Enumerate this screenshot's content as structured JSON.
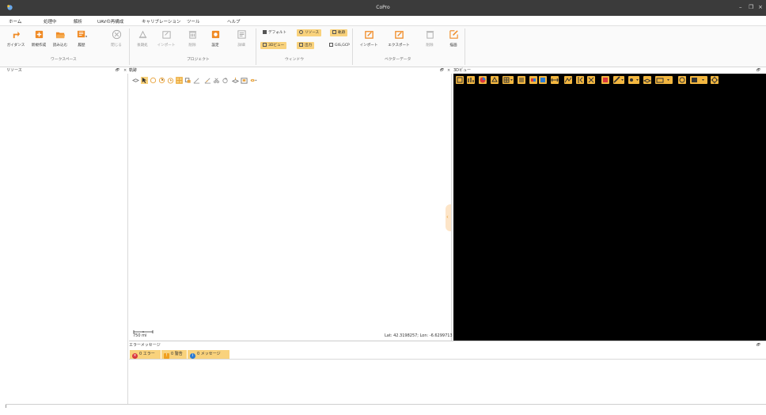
{
  "app": {
    "title": "CoPro"
  },
  "window_controls": {
    "minimize": "–",
    "restore": "❐",
    "close": "×"
  },
  "menu": {
    "tabs": [
      {
        "label": "ホーム",
        "active": true
      },
      {
        "label": "処理中"
      },
      {
        "label": "解析"
      },
      {
        "label": "UAVの再構成"
      },
      {
        "label": "キャリブレーション"
      },
      {
        "label": "ツール"
      },
      {
        "label": "ヘルプ"
      }
    ]
  },
  "ribbon": {
    "workspace": {
      "group_label": "ワークスペース",
      "buttons": [
        {
          "label": "ガイダンス",
          "icon": "guidance-icon"
        },
        {
          "label": "新規作成",
          "icon": "new-project-icon"
        },
        {
          "label": "読み込む",
          "icon": "open-folder-icon"
        },
        {
          "label": "履歴",
          "icon": "history-icon"
        },
        {
          "label": "閉じる",
          "icon": "close-circle-icon"
        }
      ]
    },
    "project": {
      "group_label": "プロジェクト",
      "buttons": [
        {
          "label": "後期処",
          "icon": "postprocess-icon"
        },
        {
          "label": "インポート",
          "icon": "import-icon"
        },
        {
          "label": "削除",
          "icon": "delete-icon"
        },
        {
          "label": "設定",
          "icon": "settings-icon"
        },
        {
          "label": "詳細",
          "icon": "details-icon"
        }
      ]
    },
    "window": {
      "group_label": "ウィンドウ",
      "items": [
        {
          "label": "デフォルト",
          "icon": "default-layout-icon",
          "active": false
        },
        {
          "label": "リソース",
          "icon": "resource-icon",
          "active": true
        },
        {
          "label": "軌跡",
          "icon": "trajectory-icon",
          "active": true
        },
        {
          "label": "3Dビュー",
          "icon": "view3d-icon",
          "active": true
        },
        {
          "label": "出力",
          "icon": "output-icon",
          "active": true
        },
        {
          "label": "GIS,GCP",
          "icon": "gis-gcp-icon",
          "active": false
        }
      ]
    },
    "vector": {
      "group_label": "ベクターデータ",
      "buttons": [
        {
          "label": "インポート",
          "icon": "vector-import-icon"
        },
        {
          "label": "エクスポート",
          "icon": "vector-export-icon"
        },
        {
          "label": "削除",
          "icon": "vector-delete-icon"
        },
        {
          "label": "描画",
          "icon": "draw-icon"
        }
      ]
    }
  },
  "panels": {
    "resources": {
      "title": "リソース",
      "pin": "🗗",
      "close": "×"
    },
    "trajectory": {
      "title": "軌跡",
      "pin": "🗗",
      "close": "×"
    },
    "view3d": {
      "title": "3Dビュー",
      "pin": "🗗"
    },
    "errors": {
      "title": "エラーメッセージ",
      "pin": "🗗"
    }
  },
  "map": {
    "scale_label": "750 mi",
    "coords": "Lat: 42.3198257; Lon: -6.6299713"
  },
  "messages": {
    "errors": "0 エラー",
    "warnings": "0 警告",
    "info": "0 メッセージ"
  },
  "colors": {
    "accent": "#f3b740",
    "active_fill": "#f9d27c",
    "titlebar": "#3b3b3b"
  }
}
